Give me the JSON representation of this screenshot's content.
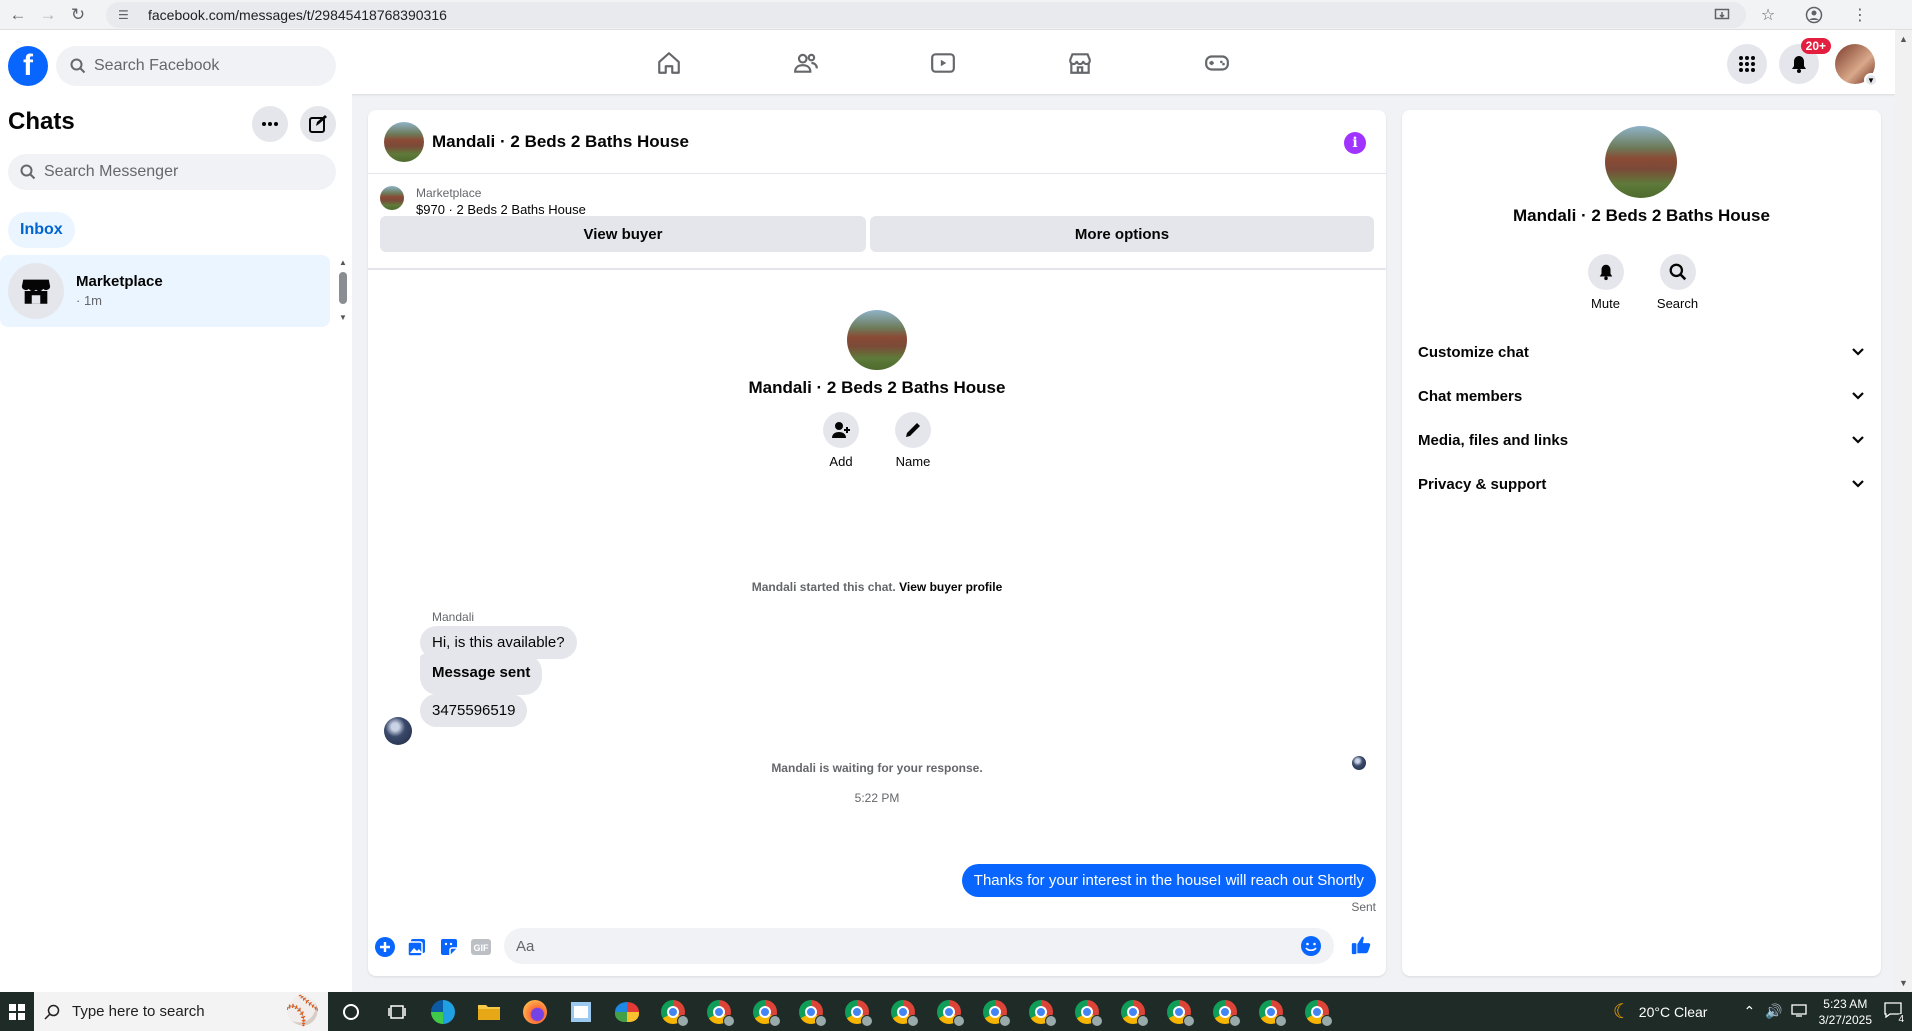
{
  "browser": {
    "url": "facebook.com/messages/t/29845418768390316"
  },
  "header": {
    "search_placeholder": "Search Facebook",
    "notif_badge": "20+"
  },
  "sidebar": {
    "title": "Chats",
    "search_placeholder": "Search Messenger",
    "filter_label": "Inbox",
    "conversations": [
      {
        "name": "Marketplace",
        "meta": "· 1m"
      }
    ]
  },
  "chat": {
    "title": "Mandali · 2 Beds 2 Baths House",
    "banner": {
      "label": "Marketplace",
      "price_line": "$970 · 2 Beds 2 Baths House",
      "view_buyer": "View buyer",
      "more_options": "More options"
    },
    "intro": {
      "title": "Mandali · 2 Beds 2 Baths House",
      "add_label": "Add",
      "name_label": "Name"
    },
    "started_text": "Mandali started this chat.",
    "view_profile": "View buyer profile",
    "sender_name": "Mandali",
    "messages": [
      {
        "text": "Hi, is this available?"
      },
      {
        "text": "Message sent"
      },
      {
        "text": "3475596519"
      }
    ],
    "waiting_text": "Mandali is waiting for your response.",
    "timestamp": "5:22 PM",
    "my_message": "Thanks for your interest in the houseI will reach out Shortly",
    "sent_label": "Sent",
    "composer_placeholder": "Aa"
  },
  "right_panel": {
    "title": "Mandali · 2 Beds 2 Baths House",
    "mute_label": "Mute",
    "search_label": "Search",
    "sections": [
      "Customize chat",
      "Chat members",
      "Media, files and links",
      "Privacy & support"
    ]
  },
  "taskbar": {
    "search_placeholder": "Type here to search",
    "weather": "20°C  Clear",
    "time": "5:23 AM",
    "date": "3/27/2025",
    "notif_count": "4"
  },
  "colors": {
    "brand": "#0866ff",
    "accent_purple": "#a033ff",
    "badge_red": "#e41e3f"
  }
}
